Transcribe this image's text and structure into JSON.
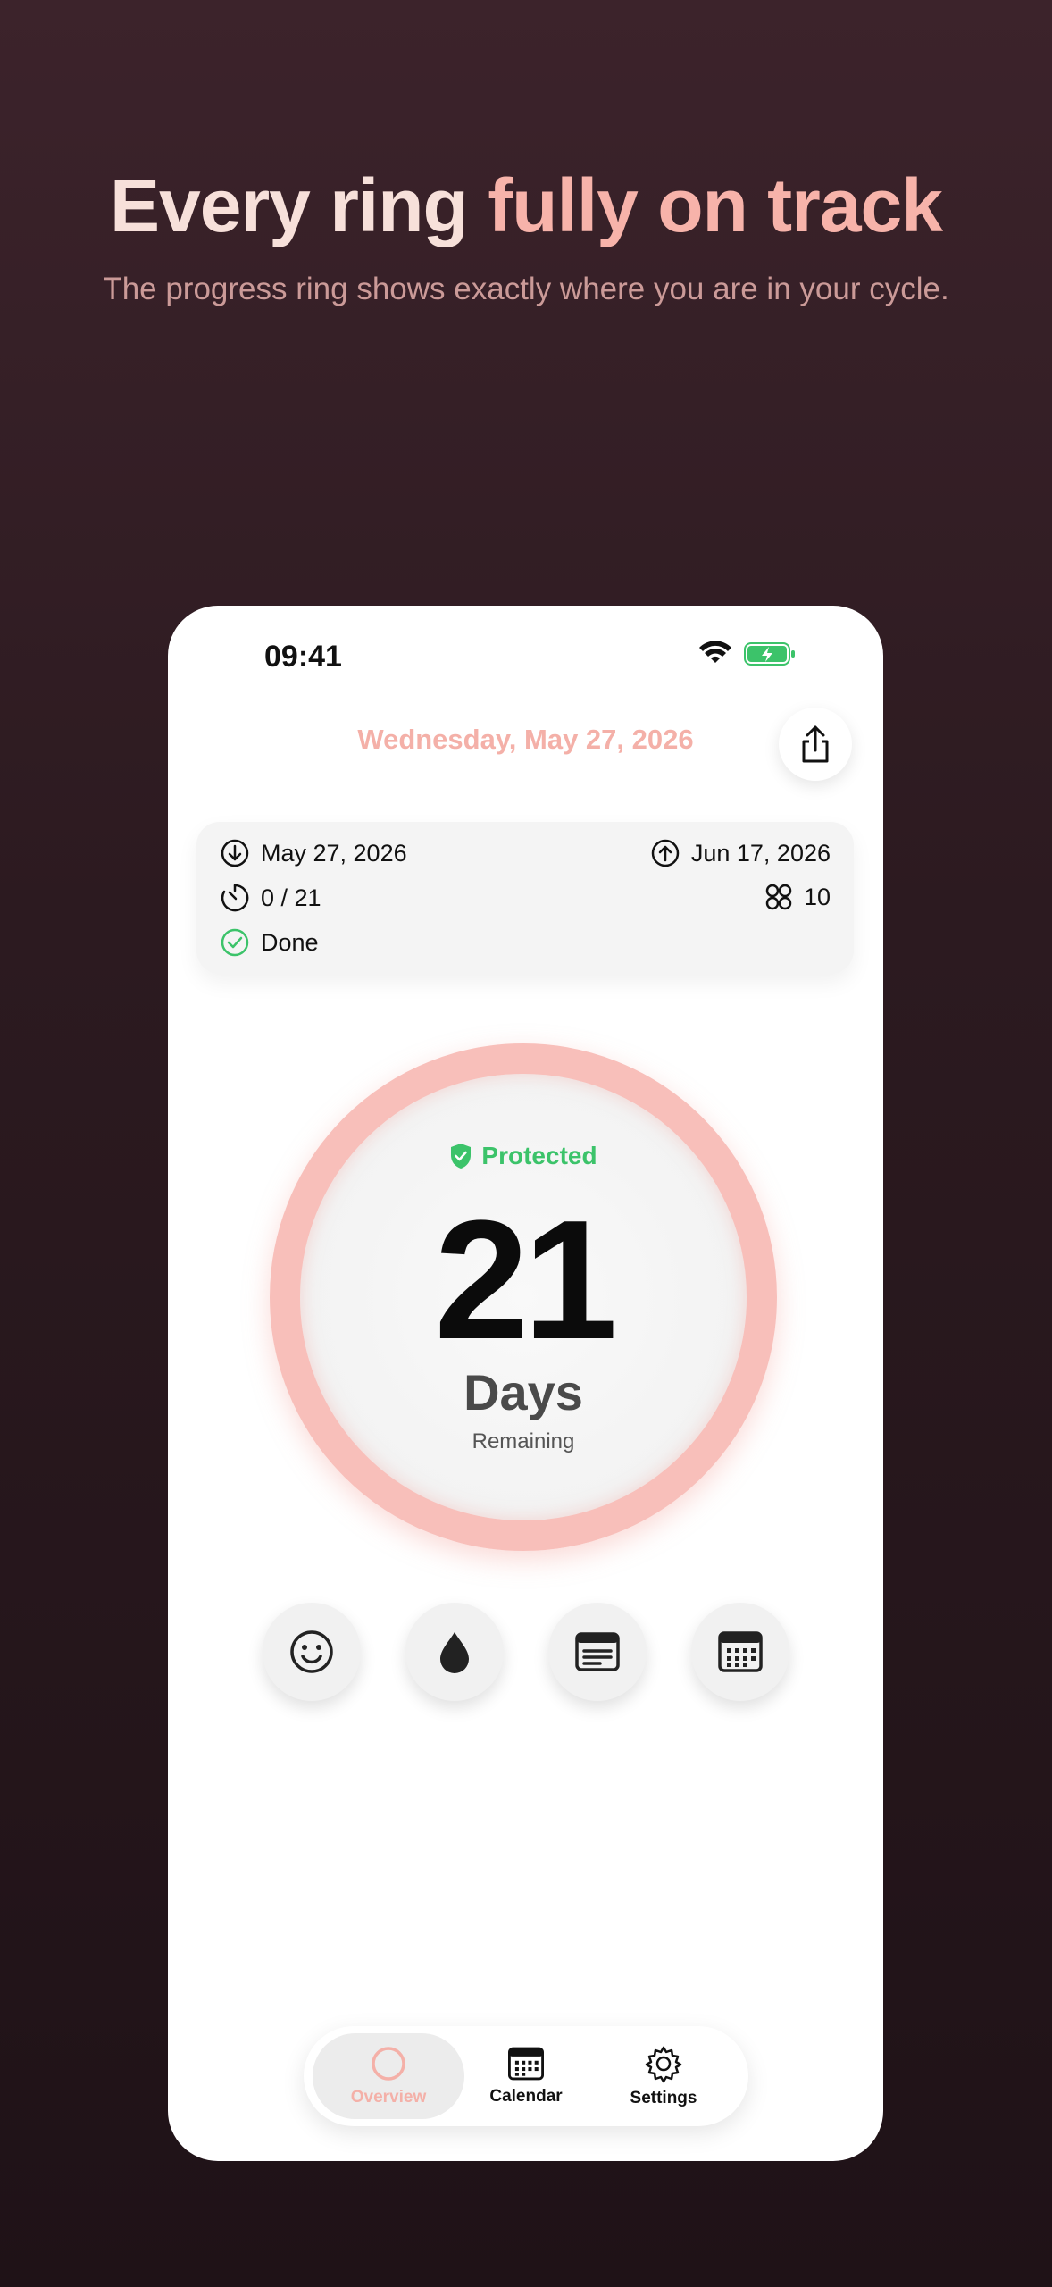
{
  "hero": {
    "headline_part1": "Every ring ",
    "headline_part2": "fully on track",
    "subheadline": "The progress ring shows exactly where you are in your cycle."
  },
  "status_bar": {
    "time": "09:41"
  },
  "header": {
    "date": "Wednesday, May 27, 2026"
  },
  "info_card": {
    "start_date": "May 27, 2026",
    "end_date": "Jun 17, 2026",
    "progress": "0 / 21",
    "count": "10",
    "done_label": "Done"
  },
  "ring": {
    "status": "Protected",
    "days_number": "21",
    "days_label": "Days",
    "sub_label": "Remaining",
    "progress_fraction": 0
  },
  "actions": [
    {
      "icon": "smiley-icon"
    },
    {
      "icon": "drop-icon"
    },
    {
      "icon": "note-icon"
    },
    {
      "icon": "calendar-icon"
    }
  ],
  "tabs": [
    {
      "label": "Overview",
      "icon": "ring-icon",
      "active": true
    },
    {
      "label": "Calendar",
      "icon": "calendar-icon",
      "active": false
    },
    {
      "label": "Settings",
      "icon": "gear-icon",
      "active": false
    }
  ],
  "colors": {
    "accent": "#f4b0a8",
    "ring": "#f8bfba",
    "success": "#3cc36a",
    "background": "#2c1a20"
  }
}
